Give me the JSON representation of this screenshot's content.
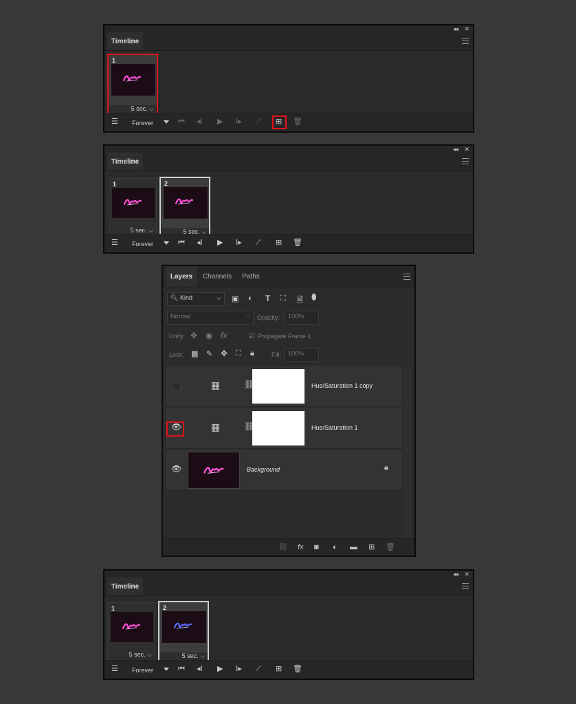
{
  "timeline1": {
    "title": "Timeline",
    "frames": [
      {
        "number": "1",
        "delay": "5 sec.",
        "selected": true,
        "glow": "#ff4fd8"
      }
    ],
    "loop": "Forever"
  },
  "timeline2": {
    "title": "Timeline",
    "frames": [
      {
        "number": "1",
        "delay": "5 sec.",
        "selected": false,
        "glow": "#ff4fd8"
      },
      {
        "number": "2",
        "delay": "5 sec.",
        "selected": true,
        "glow": "#ff4fd8"
      }
    ],
    "loop": "Forever"
  },
  "layers": {
    "tabs": [
      "Layers",
      "Channels",
      "Paths"
    ],
    "filter_kind": "Kind",
    "blend_mode": "Normal",
    "opacity_label": "Opacity:",
    "opacity_value": "100%",
    "unify_label": "Unify:",
    "propagate_label": "Propagate Frame 1",
    "lock_label": "Lock:",
    "fill_label": "Fill:",
    "fill_value": "100%",
    "rows": [
      {
        "name": "Hue/Saturation 1 copy",
        "visible": false
      },
      {
        "name": "Hue/Saturation 1",
        "visible": true
      },
      {
        "name": "Background",
        "visible": true
      }
    ]
  },
  "timeline3": {
    "title": "Timeline",
    "frames": [
      {
        "number": "1",
        "delay": "5 sec.",
        "selected": false,
        "glow": "#ff4fd8"
      },
      {
        "number": "2",
        "delay": "5 sec.",
        "selected": true,
        "glow": "#5a6bff"
      }
    ],
    "loop": "Forever"
  },
  "colors": {
    "accent_red": "#e0131b",
    "pink_glow": "#ff4fd8",
    "blue_glow": "#5a6bff"
  }
}
